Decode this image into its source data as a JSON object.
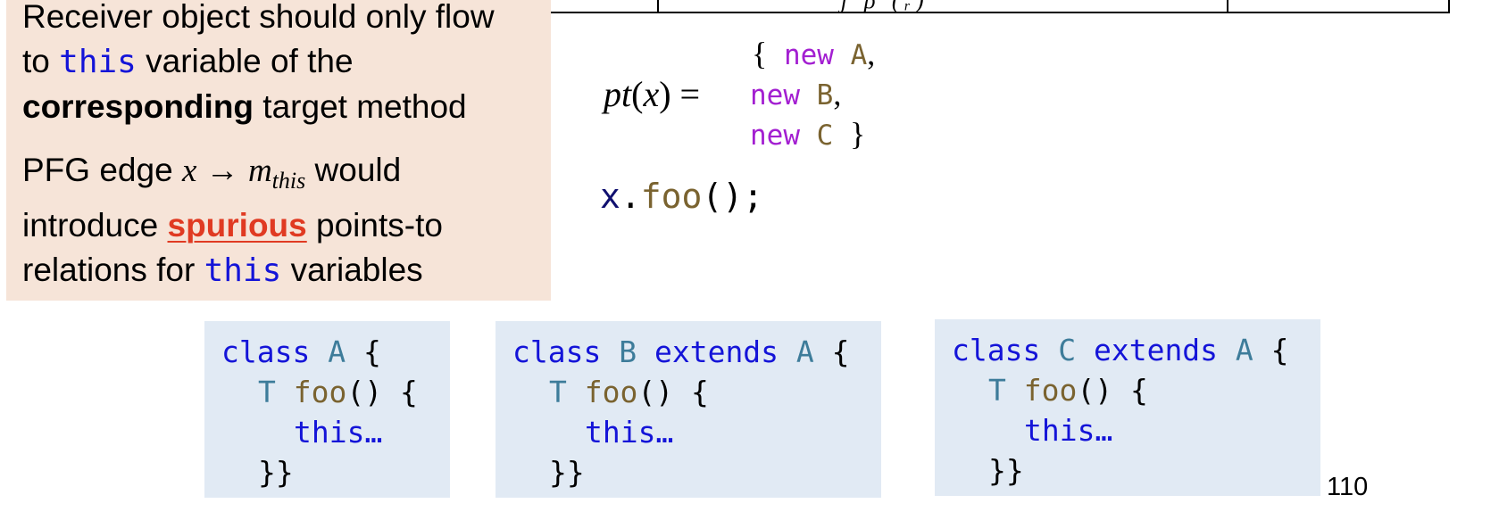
{
  "table_fragment": {
    "partial_glyphs": "ʃ ρ (ᵣ)"
  },
  "note": {
    "para1": {
      "line1": "Receiver object should only flow",
      "line2_pre": "to ",
      "line2_code": "this",
      "line2_post": " variable of the",
      "line3_bold": "corresponding",
      "line3_post": " target method"
    },
    "para2": {
      "line1_pre": "PFG edge ",
      "line1_math_x": "x",
      "line1_arrow": "→",
      "line1_math_m": "m",
      "line1_math_sub": "this",
      "line1_post": " would",
      "line2_pre": "introduce ",
      "line2_highlight": "spurious",
      "line2_post": " points-to",
      "line3_pre": "relations for ",
      "line3_code": "this",
      "line3_post": " variables"
    }
  },
  "equation": {
    "lhs_func": "pt",
    "lhs_arg": "x",
    "equals": "=",
    "open_brace": "{",
    "close_brace": "}",
    "items": [
      {
        "kw": "new",
        "cls": "A",
        "sep": ","
      },
      {
        "kw": "new",
        "cls": "B",
        "sep": ","
      },
      {
        "kw": "new",
        "cls": "C",
        "sep": ""
      }
    ]
  },
  "call": {
    "receiver": "x",
    "dot": ".",
    "method": "foo",
    "args": "();"
  },
  "classes": [
    {
      "kw_class": "class",
      "name": "A",
      "extends_kw": "",
      "parent": "",
      "brace": "{",
      "ret_type": "T",
      "method": "foo",
      "method_tail": "() {",
      "body": "this…",
      "close": "}}"
    },
    {
      "kw_class": "class",
      "name": "B",
      "extends_kw": "extends",
      "parent": "A",
      "brace": "{",
      "ret_type": "T",
      "method": "foo",
      "method_tail": "() {",
      "body": "this…",
      "close": "}}"
    },
    {
      "kw_class": "class",
      "name": "C",
      "extends_kw": "extends",
      "parent": "A",
      "brace": "{",
      "ret_type": "T",
      "method": "foo",
      "method_tail": "() {",
      "body": "this…",
      "close": "}}"
    }
  ],
  "page_number": "110",
  "colors": {
    "note_bg": "#f6e4d8",
    "code_keyword": "#1414d8",
    "code_type": "#3d7c9a",
    "code_method": "#7a6330",
    "new_keyword": "#a31fd1",
    "highlight_red": "#e03a22",
    "code_box_bg": "#e1eaf4"
  }
}
